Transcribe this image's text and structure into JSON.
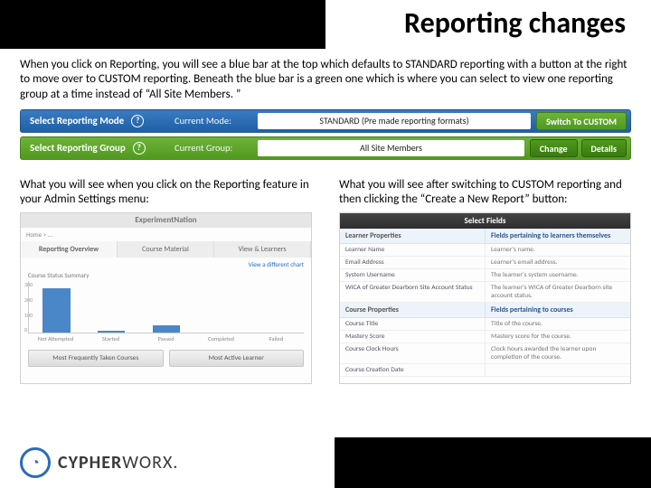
{
  "title": "Reporting changes",
  "intro": "When you click on Reporting, you will see a blue bar at the top which defaults to STANDARD reporting with a button at the right to move over to CUSTOM reporting. Beneath the blue bar is a green one which is where you can select to view one reporting group at a time instead of “All Site Members. ”",
  "bars": {
    "mode": {
      "label": "Select Reporting Mode",
      "current_label": "Current Mode:",
      "value": "STANDARD (Pre made reporting formats)",
      "switch_btn": "Switch To CUSTOM"
    },
    "group": {
      "label": "Select Reporting Group",
      "current_label": "Current Group:",
      "value": "All Site Members",
      "change_btn": "Change",
      "details_btn": "Details"
    }
  },
  "columns": {
    "left_caption": "What you will see when you click on the Reporting feature in your Admin Settings menu:",
    "right_caption": "What you will see after switching to CUSTOM reporting and then clicking the “Create a New Report” button:"
  },
  "left_panel": {
    "header": "ExperimentNation",
    "breadcrumb": "Home > ... ",
    "tabs": [
      "Reporting Overview",
      "Course Material",
      "View & Learners"
    ],
    "chart_link": "View a different chart",
    "chart_title": "Course Status Summary",
    "buttons": [
      "Most Frequently Taken Courses",
      "Most Active Learner"
    ]
  },
  "right_panel": {
    "header": "Select Fields",
    "col_left_hdr": "Learner Properties",
    "col_right_hdr": "Fields pertaining to learners themselves",
    "learner_rows": [
      [
        "Learner Name",
        "Learner's name."
      ],
      [
        "Email Address",
        "Learner's email address."
      ],
      [
        "System Username",
        "The learner's system username."
      ],
      [
        "WICA of Greater Dearborn Site Account Status",
        "The learner's WICA of Greater Dearborn site account status."
      ]
    ],
    "course_section_left": "Course Properties",
    "course_section_right": "Fields pertaining to courses",
    "course_rows": [
      [
        "Course Title",
        "Title of the course."
      ],
      [
        "Mastery Score",
        "Mastery score for the course."
      ],
      [
        "Course Clock Hours",
        "Clock hours awarded the learner upon completion of the course."
      ],
      [
        "Course Creation Date",
        ""
      ]
    ]
  },
  "chart_data": {
    "type": "bar",
    "title": "Course Status Summary",
    "categories": [
      "Not Attempted",
      "Started",
      "Passed",
      "Completed",
      "Failed"
    ],
    "values": [
      260,
      13,
      45,
      0,
      0
    ],
    "ylim": [
      0,
      300
    ],
    "yticks": [
      300,
      200,
      100,
      0
    ],
    "xlabel": "",
    "ylabel": ""
  },
  "logo": {
    "prefix": "CYPHER",
    "suffix": "WORX"
  }
}
